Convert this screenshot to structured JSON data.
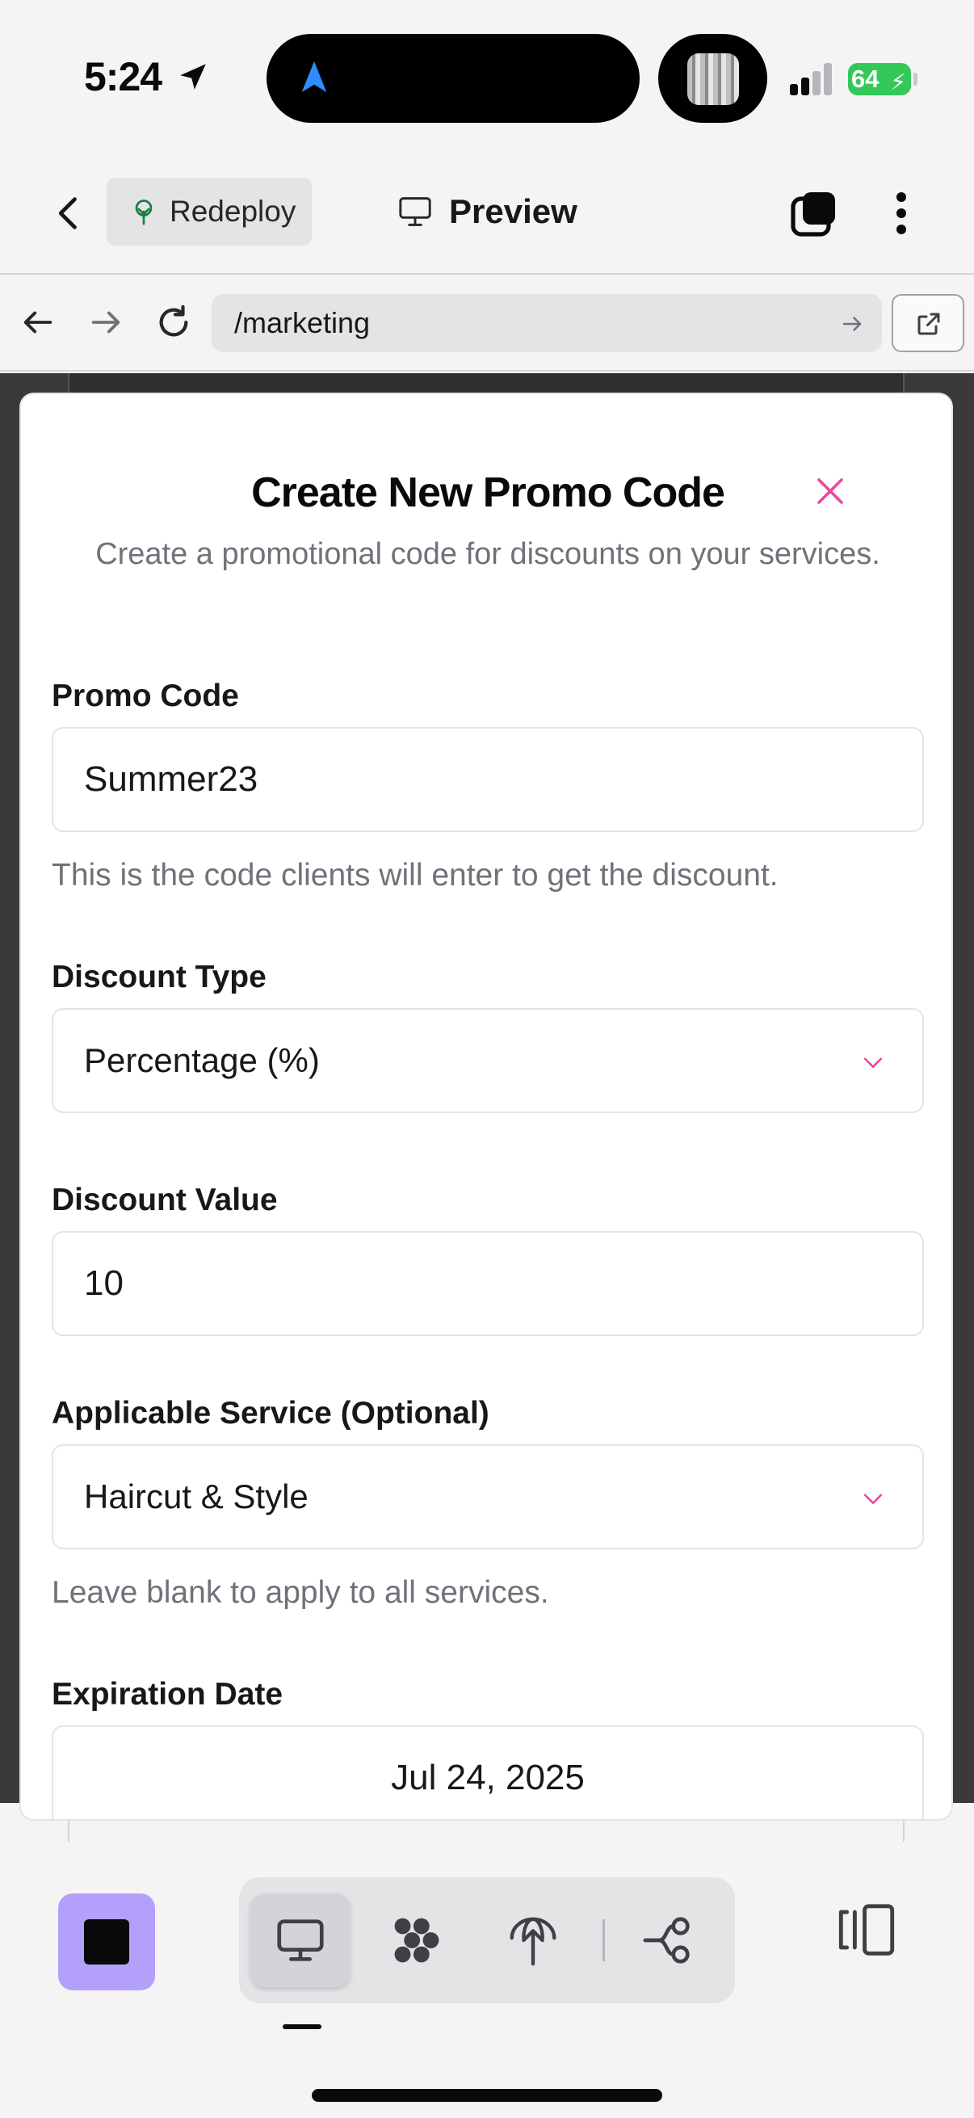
{
  "status_bar": {
    "time": "5:24",
    "battery": "64"
  },
  "header": {
    "redeploy_label": "Redeploy",
    "preview_label": "Preview"
  },
  "browser": {
    "url": "/marketing"
  },
  "modal": {
    "title": "Create New Promo Code",
    "description": "Create a promotional code for discounts on your services.",
    "fields": {
      "promo_code": {
        "label": "Promo Code",
        "value": "Summer23",
        "help": "This is the code clients will enter to get the discount."
      },
      "discount_type": {
        "label": "Discount Type",
        "value": "Percentage (%)"
      },
      "discount_value": {
        "label": "Discount Value",
        "value": "10"
      },
      "applicable_service": {
        "label": "Applicable Service (Optional)",
        "value": "Haircut & Style",
        "help": "Leave blank to apply to all services."
      },
      "expiration_date": {
        "label": "Expiration Date",
        "value": "Jul 24, 2025"
      }
    }
  },
  "colors": {
    "accent": "#ec4899",
    "stop_button": "#b4a0fb",
    "battery": "#34c759",
    "island_arrow": "#2f8cff"
  },
  "toolbar": {
    "icons": [
      "stop-icon",
      "monitor-icon",
      "dots-icon",
      "deploy-icon",
      "workflow-icon",
      "split-view-icon"
    ]
  }
}
